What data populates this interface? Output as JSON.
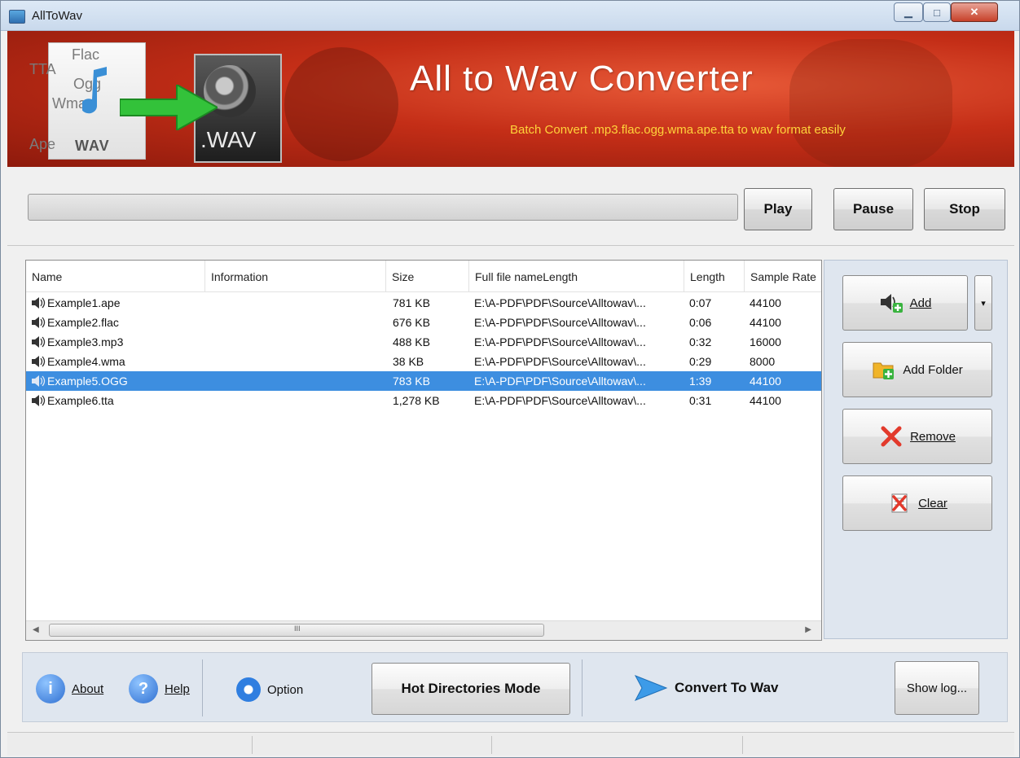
{
  "window": {
    "title": "AllToWav",
    "controls": [
      "minimize",
      "maximize",
      "close"
    ]
  },
  "banner": {
    "title": "All to Wav Converter",
    "subtitle": "Batch Convert  .mp3.flac.ogg.wma.ape.tta to wav  format easily",
    "formats": [
      "Flac",
      "TTA",
      "Ogg",
      "Wma",
      "Ape",
      "WAV"
    ],
    "wav_label": ".WAV"
  },
  "player": {
    "progress": 0,
    "play": "Play",
    "pause": "Pause",
    "stop": "Stop"
  },
  "list": {
    "columns": [
      "Name",
      "Information",
      "Size",
      "Full file nameLength",
      "Length",
      "Sample Rate"
    ],
    "rows": [
      {
        "name": "Example1.ape",
        "info": "",
        "size": "781 KB",
        "path": "E:\\A-PDF\\PDF\\Source\\Alltowav\\...",
        "length": "0:07",
        "rate": "44100",
        "selected": false
      },
      {
        "name": "Example2.flac",
        "info": "",
        "size": "676 KB",
        "path": "E:\\A-PDF\\PDF\\Source\\Alltowav\\...",
        "length": "0:06",
        "rate": "44100",
        "selected": false
      },
      {
        "name": "Example3.mp3",
        "info": "",
        "size": "488 KB",
        "path": "E:\\A-PDF\\PDF\\Source\\Alltowav\\...",
        "length": "0:32",
        "rate": "16000",
        "selected": false
      },
      {
        "name": "Example4.wma",
        "info": "",
        "size": "38 KB",
        "path": "E:\\A-PDF\\PDF\\Source\\Alltowav\\...",
        "length": "0:29",
        "rate": "8000",
        "selected": false
      },
      {
        "name": "Example5.OGG",
        "info": "",
        "size": "783 KB",
        "path": "E:\\A-PDF\\PDF\\Source\\Alltowav\\...",
        "length": "1:39",
        "rate": "44100",
        "selected": true
      },
      {
        "name": "Example6.tta",
        "info": "",
        "size": "1,278 KB",
        "path": "E:\\A-PDF\\PDF\\Source\\Alltowav\\...",
        "length": "0:31",
        "rate": "44100",
        "selected": false
      }
    ],
    "scroll_grip": "III"
  },
  "side": {
    "add": "Add",
    "add_folder": "Add Folder",
    "remove": "Remove",
    "clear": "Clear"
  },
  "bottom": {
    "about": "About",
    "help": "Help",
    "option": "Option",
    "hot_dirs": "Hot Directories Mode",
    "convert": "Convert To Wav",
    "show_log": "Show log..."
  },
  "colors": {
    "banner": "#c42e17",
    "selection": "#3d8ee0",
    "subtitle": "#ffd33a",
    "panel": "#dfe6ef"
  }
}
